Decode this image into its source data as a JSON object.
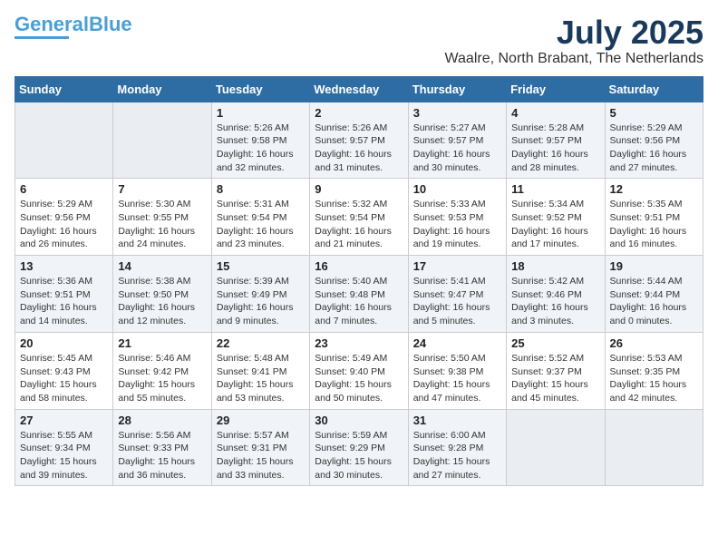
{
  "logo": {
    "line1": "General",
    "line2": "Blue"
  },
  "title": "July 2025",
  "location": "Waalre, North Brabant, The Netherlands",
  "days_of_week": [
    "Sunday",
    "Monday",
    "Tuesday",
    "Wednesday",
    "Thursday",
    "Friday",
    "Saturday"
  ],
  "weeks": [
    [
      {
        "day": "",
        "detail": ""
      },
      {
        "day": "",
        "detail": ""
      },
      {
        "day": "1",
        "detail": "Sunrise: 5:26 AM\nSunset: 9:58 PM\nDaylight: 16 hours and 32 minutes."
      },
      {
        "day": "2",
        "detail": "Sunrise: 5:26 AM\nSunset: 9:57 PM\nDaylight: 16 hours and 31 minutes."
      },
      {
        "day": "3",
        "detail": "Sunrise: 5:27 AM\nSunset: 9:57 PM\nDaylight: 16 hours and 30 minutes."
      },
      {
        "day": "4",
        "detail": "Sunrise: 5:28 AM\nSunset: 9:57 PM\nDaylight: 16 hours and 28 minutes."
      },
      {
        "day": "5",
        "detail": "Sunrise: 5:29 AM\nSunset: 9:56 PM\nDaylight: 16 hours and 27 minutes."
      }
    ],
    [
      {
        "day": "6",
        "detail": "Sunrise: 5:29 AM\nSunset: 9:56 PM\nDaylight: 16 hours and 26 minutes."
      },
      {
        "day": "7",
        "detail": "Sunrise: 5:30 AM\nSunset: 9:55 PM\nDaylight: 16 hours and 24 minutes."
      },
      {
        "day": "8",
        "detail": "Sunrise: 5:31 AM\nSunset: 9:54 PM\nDaylight: 16 hours and 23 minutes."
      },
      {
        "day": "9",
        "detail": "Sunrise: 5:32 AM\nSunset: 9:54 PM\nDaylight: 16 hours and 21 minutes."
      },
      {
        "day": "10",
        "detail": "Sunrise: 5:33 AM\nSunset: 9:53 PM\nDaylight: 16 hours and 19 minutes."
      },
      {
        "day": "11",
        "detail": "Sunrise: 5:34 AM\nSunset: 9:52 PM\nDaylight: 16 hours and 17 minutes."
      },
      {
        "day": "12",
        "detail": "Sunrise: 5:35 AM\nSunset: 9:51 PM\nDaylight: 16 hours and 16 minutes."
      }
    ],
    [
      {
        "day": "13",
        "detail": "Sunrise: 5:36 AM\nSunset: 9:51 PM\nDaylight: 16 hours and 14 minutes."
      },
      {
        "day": "14",
        "detail": "Sunrise: 5:38 AM\nSunset: 9:50 PM\nDaylight: 16 hours and 12 minutes."
      },
      {
        "day": "15",
        "detail": "Sunrise: 5:39 AM\nSunset: 9:49 PM\nDaylight: 16 hours and 9 minutes."
      },
      {
        "day": "16",
        "detail": "Sunrise: 5:40 AM\nSunset: 9:48 PM\nDaylight: 16 hours and 7 minutes."
      },
      {
        "day": "17",
        "detail": "Sunrise: 5:41 AM\nSunset: 9:47 PM\nDaylight: 16 hours and 5 minutes."
      },
      {
        "day": "18",
        "detail": "Sunrise: 5:42 AM\nSunset: 9:46 PM\nDaylight: 16 hours and 3 minutes."
      },
      {
        "day": "19",
        "detail": "Sunrise: 5:44 AM\nSunset: 9:44 PM\nDaylight: 16 hours and 0 minutes."
      }
    ],
    [
      {
        "day": "20",
        "detail": "Sunrise: 5:45 AM\nSunset: 9:43 PM\nDaylight: 15 hours and 58 minutes."
      },
      {
        "day": "21",
        "detail": "Sunrise: 5:46 AM\nSunset: 9:42 PM\nDaylight: 15 hours and 55 minutes."
      },
      {
        "day": "22",
        "detail": "Sunrise: 5:48 AM\nSunset: 9:41 PM\nDaylight: 15 hours and 53 minutes."
      },
      {
        "day": "23",
        "detail": "Sunrise: 5:49 AM\nSunset: 9:40 PM\nDaylight: 15 hours and 50 minutes."
      },
      {
        "day": "24",
        "detail": "Sunrise: 5:50 AM\nSunset: 9:38 PM\nDaylight: 15 hours and 47 minutes."
      },
      {
        "day": "25",
        "detail": "Sunrise: 5:52 AM\nSunset: 9:37 PM\nDaylight: 15 hours and 45 minutes."
      },
      {
        "day": "26",
        "detail": "Sunrise: 5:53 AM\nSunset: 9:35 PM\nDaylight: 15 hours and 42 minutes."
      }
    ],
    [
      {
        "day": "27",
        "detail": "Sunrise: 5:55 AM\nSunset: 9:34 PM\nDaylight: 15 hours and 39 minutes."
      },
      {
        "day": "28",
        "detail": "Sunrise: 5:56 AM\nSunset: 9:33 PM\nDaylight: 15 hours and 36 minutes."
      },
      {
        "day": "29",
        "detail": "Sunrise: 5:57 AM\nSunset: 9:31 PM\nDaylight: 15 hours and 33 minutes."
      },
      {
        "day": "30",
        "detail": "Sunrise: 5:59 AM\nSunset: 9:29 PM\nDaylight: 15 hours and 30 minutes."
      },
      {
        "day": "31",
        "detail": "Sunrise: 6:00 AM\nSunset: 9:28 PM\nDaylight: 15 hours and 27 minutes."
      },
      {
        "day": "",
        "detail": ""
      },
      {
        "day": "",
        "detail": ""
      }
    ]
  ]
}
